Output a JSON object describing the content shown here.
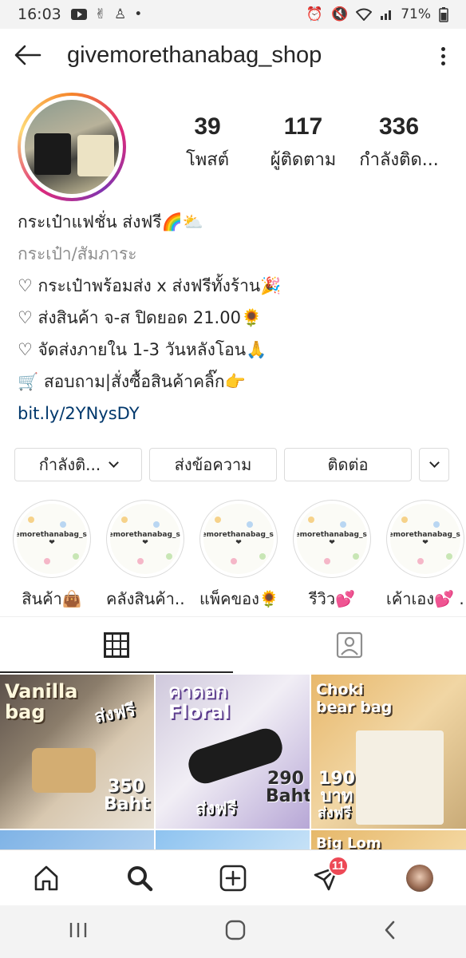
{
  "status_bar": {
    "time": "16:03",
    "battery": "71%"
  },
  "header": {
    "username": "givemorethanabag_shop"
  },
  "stats": [
    {
      "number": "39",
      "label": "โพสต์"
    },
    {
      "number": "117",
      "label": "ผู้ติดตาม"
    },
    {
      "number": "336",
      "label": "กำลังติด..."
    }
  ],
  "bio": {
    "name": "กระเป๋าแฟชั่น ส่งฟรี🌈⛅",
    "category": "กระเป๋า/สัมภาระ",
    "lines": [
      "♡ กระเป๋าพร้อมส่ง x ส่งฟรีทั้งร้าน🎉",
      "♡ ส่งสินค้า จ-ส ปิดยอด 21.00🌻",
      "♡ จัดส่งภายใน 1-3 วันหลังโอน🙏",
      "🛒 สอบถาม|สั่งซื้อสินค้าคลิ๊ก👉"
    ],
    "link": "bit.ly/2YNysDY"
  },
  "actions": {
    "following": "กำลังติ...",
    "message": "ส่งข้อความ",
    "contact": "ติดต่อ"
  },
  "highlights": [
    {
      "label": "สินค้า👜",
      "cover_text": "Givemorethanabag_shop❤"
    },
    {
      "label": "คลังสินค้า...",
      "cover_text": "Givemorethanabag_shop❤"
    },
    {
      "label": "แพ็คของ🌻",
      "cover_text": "Givemorethanabag_shop❤"
    },
    {
      "label": "รีวิว💕",
      "cover_text": "Givemorethanabag_shop❤"
    },
    {
      "label": "เค้าเอง💕 ...",
      "cover_text": "Givemorethanabag_shop❤"
    }
  ],
  "posts": [
    {
      "title": "Vanilla bag",
      "tag": "ส่งฟรี",
      "price": "350 Baht"
    },
    {
      "title": "คาดอก Floral",
      "tag": "ส่งฟรี",
      "price": "290 Baht"
    },
    {
      "title": "Choki bear bag",
      "tag": "ส่งฟรี",
      "price": "190 บาท"
    },
    {
      "title": "",
      "tag": "",
      "price": ""
    },
    {
      "title": "",
      "tag": "",
      "price": ""
    },
    {
      "title": "Big Lom",
      "tag": "",
      "price": ""
    }
  ],
  "bottom_nav": {
    "messages_badge": "11"
  },
  "colors": {
    "link": "#00376b",
    "badge": "#ed4956",
    "divider": "#dbdbdb"
  }
}
